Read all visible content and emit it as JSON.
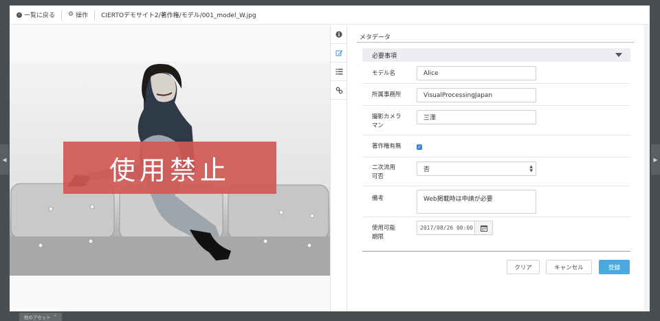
{
  "topbar": {
    "back_label": "一覧に戻る",
    "ops_label": "操作",
    "path": "CIERTOデモサイト2/著作権/モデル/001_model_W.jpg"
  },
  "viewer": {
    "forbidden_label": "使用禁止"
  },
  "tabs": [
    {
      "name": "info-icon",
      "active": false
    },
    {
      "name": "edit-icon",
      "active": true
    },
    {
      "name": "list-icon",
      "active": false
    },
    {
      "name": "link-icon",
      "active": false
    }
  ],
  "panel": {
    "title": "メタデータ",
    "section_title": "必要事項",
    "fields": {
      "model_name": {
        "label": "モデル名",
        "value": "Alice"
      },
      "agency": {
        "label": "所属事務所",
        "value": "VisualProcessingJapan"
      },
      "cameraman": {
        "label": "撮影カメラマン",
        "value": "三澤"
      },
      "copyright": {
        "label": "著作権有無",
        "checked": true
      },
      "secondary_use": {
        "label": "二次流用可否",
        "value": "否"
      },
      "notes": {
        "label": "備考",
        "value": "Web掲載時は申請が必要"
      },
      "usage_period": {
        "label": "使用可能期限",
        "value": "2017/08/26 00:00"
      }
    },
    "buttons": {
      "clear": "クリア",
      "cancel": "キャンセル",
      "register": "登録"
    }
  },
  "bottom_tab": {
    "label": "他のアセット"
  },
  "colors": {
    "accent": "#4aa9e0",
    "checkbox": "#3b86d6",
    "forbidden_banner": "#d05854",
    "backdrop": "#4a4d52"
  }
}
